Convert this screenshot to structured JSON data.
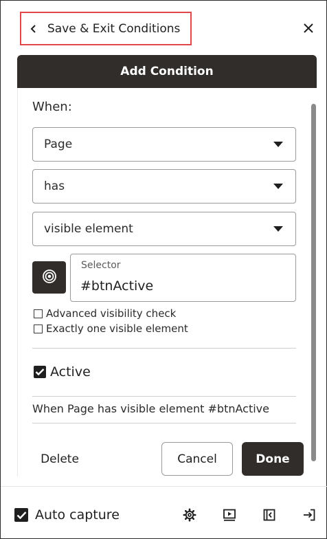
{
  "header": {
    "back_label": "Save & Exit Conditions",
    "back_icon": "chevron-left-icon",
    "close_icon": "close-icon"
  },
  "panel": {
    "title": "Add Condition",
    "when_label": "When:",
    "subject_select": {
      "value": "Page"
    },
    "operator_select": {
      "value": "has"
    },
    "condition_select": {
      "value": "visible element"
    },
    "selector": {
      "label": "Selector",
      "value": "#btnActive",
      "picker_icon": "target-icon"
    },
    "options": [
      {
        "label": "Advanced visibility check",
        "checked": false
      },
      {
        "label": "Exactly one visible element",
        "checked": false
      }
    ],
    "active": {
      "label": "Active",
      "checked": true
    },
    "summary": "When Page has visible element #btnActive",
    "buttons": {
      "delete": "Delete",
      "cancel": "Cancel",
      "done": "Done"
    }
  },
  "footer": {
    "auto_capture": {
      "label": "Auto capture",
      "checked": true
    },
    "icons": [
      "gear-icon",
      "play-screen-icon",
      "collapse-panel-icon",
      "exit-icon"
    ]
  },
  "colors": {
    "dark": "#312d2a",
    "highlight": "#e0464a",
    "border": "#9a9a9a"
  }
}
